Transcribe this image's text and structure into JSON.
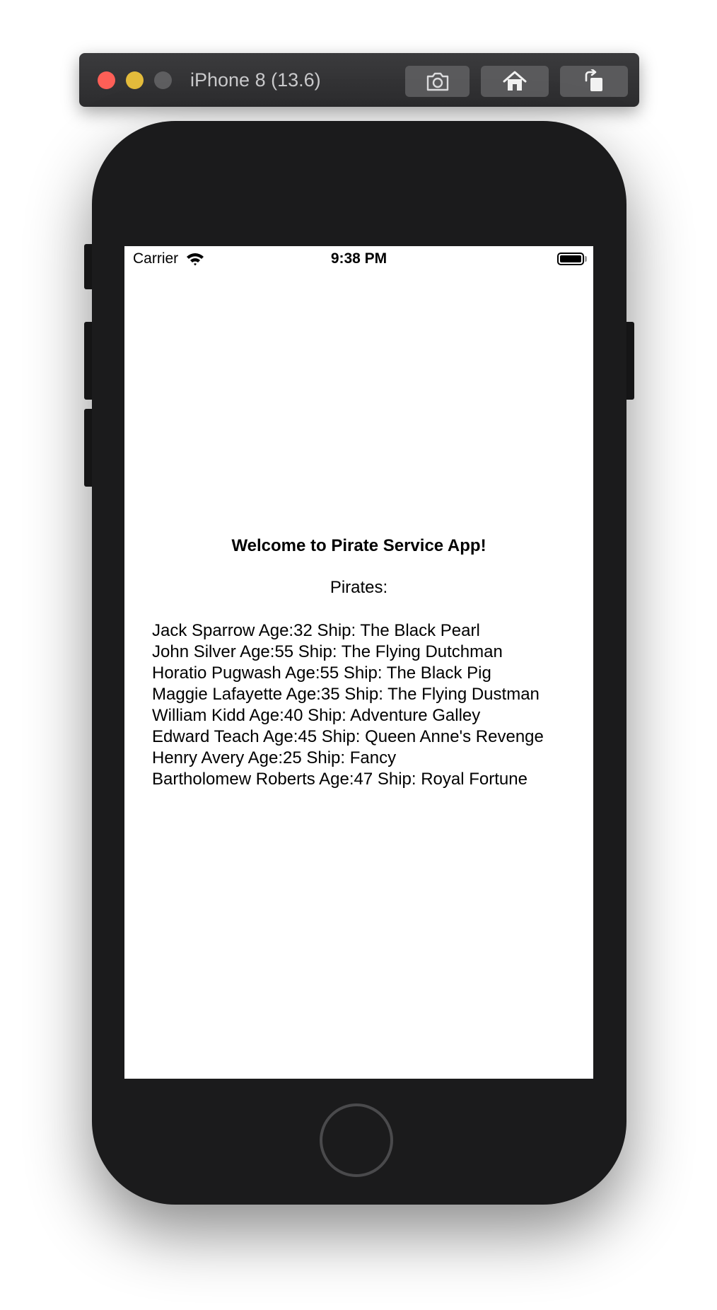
{
  "simulator": {
    "title": "iPhone 8 (13.6)",
    "buttons": [
      {
        "icon": "camera-icon",
        "label": "screenshot"
      },
      {
        "icon": "home-icon",
        "label": "home"
      },
      {
        "icon": "rotate-icon",
        "label": "rotate"
      }
    ]
  },
  "statusbar": {
    "carrier": "Carrier",
    "time": "9:38 PM"
  },
  "app": {
    "welcome": "Welcome to Pirate Service App!",
    "pirates_label": "Pirates:",
    "pirates": [
      "Jack Sparrow Age:32 Ship: The Black Pearl",
      "John Silver Age:55 Ship: The Flying Dutchman",
      "Horatio Pugwash Age:55 Ship: The Black Pig",
      "Maggie Lafayette Age:35 Ship: The Flying Dustman",
      "William Kidd Age:40 Ship: Adventure Galley",
      "Edward Teach Age:45 Ship: Queen Anne's Revenge",
      "Henry Avery Age:25 Ship: Fancy",
      "Bartholomew Roberts Age:47 Ship: Royal Fortune"
    ]
  },
  "colors": {
    "close": "#fe5f57",
    "minimize": "#e3bb3b",
    "zoom_disabled": "#5e5e60",
    "phone_body": "#1b1b1c"
  }
}
